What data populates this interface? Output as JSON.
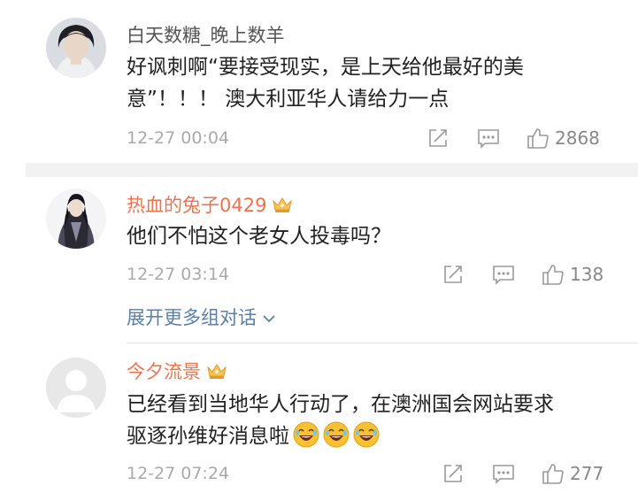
{
  "colors": {
    "vip_name": "#eb7350",
    "plain_name": "#555555",
    "text": "#222222",
    "meta": "#aaaaaa",
    "link": "#5b7fa6",
    "section_bg": "#f2f2f2"
  },
  "comments": [
    {
      "username": "白天数糖_晚上数羊",
      "vip": false,
      "text_lines": [
        "好讽刺啊“要接受现实，是上天给他最好的美",
        "意”！！！ 澳大利亚华人请给力一点"
      ],
      "time": "12-27 00:04",
      "likes": "2868",
      "icons": [
        "share-icon",
        "comment-icon",
        "like-icon"
      ]
    },
    {
      "username": "热血的兔子0429",
      "vip": true,
      "text_lines": [
        "他们不怕这个老女人投毒吗？"
      ],
      "time": "12-27 03:14",
      "likes": "138",
      "icons": [
        "crown-badge-icon",
        "share-icon",
        "comment-icon",
        "like-icon"
      ]
    },
    {
      "username": "今夕流景",
      "vip": true,
      "text_lines": [
        "已经看到当地华人行动了，在澳洲国会网站要求",
        "驱逐孙维好消息啦"
      ],
      "emojis": [
        "laughing-emoji-icon",
        "laughing-emoji-icon",
        "laughing-emoji-icon"
      ],
      "time": "12-27 07:24",
      "likes": "277",
      "icons": [
        "crown-badge-icon",
        "share-icon",
        "comment-icon",
        "like-icon"
      ]
    }
  ],
  "expand_replies": {
    "label": "展开更多组对话",
    "icon": "chevron-down-icon"
  }
}
